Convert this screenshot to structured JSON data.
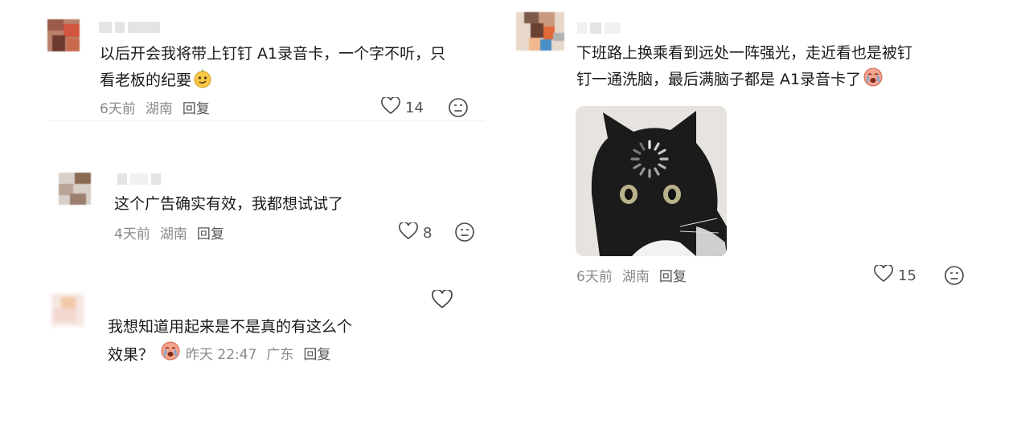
{
  "comments": [
    {
      "text_line1": "以后开会我将带上钉钉 A1录音卡，一个字不听，只",
      "text_line2": "看老板的纪要",
      "emoji": "smirk-emoji",
      "time": "6天前",
      "location": "湖南",
      "reply": "回复",
      "likes": "14"
    },
    {
      "text_line1": "这个广告确实有效，我都想试试了",
      "time": "4天前",
      "location": "湖南",
      "reply": "回复",
      "likes": "8"
    },
    {
      "text_line1": "我想知道用起来是不是真的有这么个",
      "text_line2": "效果？",
      "emoji": "crying-emoji",
      "time": "昨天 22:47",
      "location": "广东",
      "reply": "回复"
    },
    {
      "text_line1": "下班路上换乘看到远处一阵强光，走近看也是被钉",
      "text_line2": "钉一通洗脑，最后满脑子都是 A1录音卡了",
      "emoji": "crying-emoji",
      "image": "cat-loading-meme",
      "time": "6天前",
      "location": "湖南",
      "reply": "回复",
      "likes": "15"
    }
  ],
  "colors": {
    "meta": "#8a8a8a",
    "text": "#1a1a1a",
    "icon": "#555555"
  }
}
